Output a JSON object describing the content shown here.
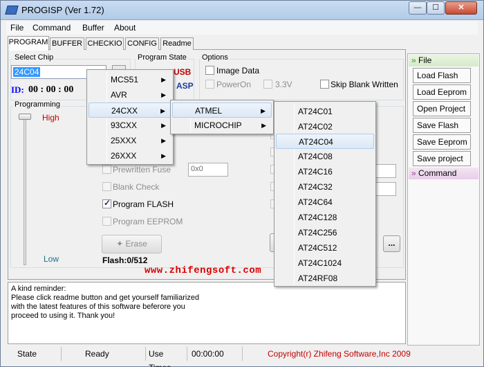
{
  "window": {
    "title": "PROGISP (Ver 1.72)",
    "min": "—",
    "max": "☐",
    "close": "✕"
  },
  "menubar": [
    "File",
    "Command",
    "Buffer",
    "About"
  ],
  "tabs": [
    "PROGRAM",
    "BUFFER",
    "CHECKIO",
    "CONFIG",
    "Readme"
  ],
  "select_chip": {
    "label": "Select Chip",
    "value": "24C04",
    "button": "..."
  },
  "id": {
    "label": "ID:",
    "value": "00 : 00 : 00"
  },
  "program_state": {
    "label": "Program State",
    "logo_top": "USB",
    "logo_bottom": "ASP"
  },
  "options": {
    "label": "Options",
    "image_data": "Image Data",
    "power_on": "PowerOn",
    "voltage": "3.3V",
    "skip_blank": "Skip Blank Written"
  },
  "programming": {
    "label": "Programming",
    "high": "High",
    "low": "Low",
    "prewritten_fuse": "Prewritten Fuse",
    "prewritten_value": "0x0",
    "blank_check": "Blank Check",
    "program_flash": "Program FLASH",
    "program_eeprom": "Program EEPROM",
    "erase": "Erase",
    "flash_info": "Flash:0/512",
    "more_button": "..."
  },
  "website": "www.zhifengsoft.com",
  "reminder": [
    "A kind reminder:",
    "Please click readme button and get yourself familiarized",
    "with the latest features of this software beferore you",
    "proceed to using it. Thank you!"
  ],
  "status": {
    "state_label": "State",
    "state_value": "Ready",
    "use_times_label": "Use Times",
    "use_times_value": "00:00:00",
    "copyright": "Copyright(r) Zhifeng Software,Inc 2009"
  },
  "side": {
    "file_header": "File",
    "buttons": [
      "Load Flash",
      "Load Eeprom",
      "Open Project",
      "Save Flash",
      "Save Eeprom",
      "Save project"
    ],
    "command_header": "Command"
  },
  "menus": {
    "families": [
      "MCS51",
      "AVR",
      "24CXX",
      "93CXX",
      "25XXX",
      "26XXX"
    ],
    "vendors": [
      "ATMEL",
      "MICROCHIP"
    ],
    "chips": [
      "AT24C01",
      "AT24C02",
      "AT24C04",
      "AT24C08",
      "AT24C16",
      "AT24C32",
      "AT24C64",
      "AT24C128",
      "AT24C256",
      "AT24C512",
      "AT24C1024",
      "AT24RF08"
    ]
  },
  "colors": {
    "accent": "#3399ff",
    "website": "#d90000",
    "id_blue": "#0000ff",
    "high_red": "#c00000"
  }
}
